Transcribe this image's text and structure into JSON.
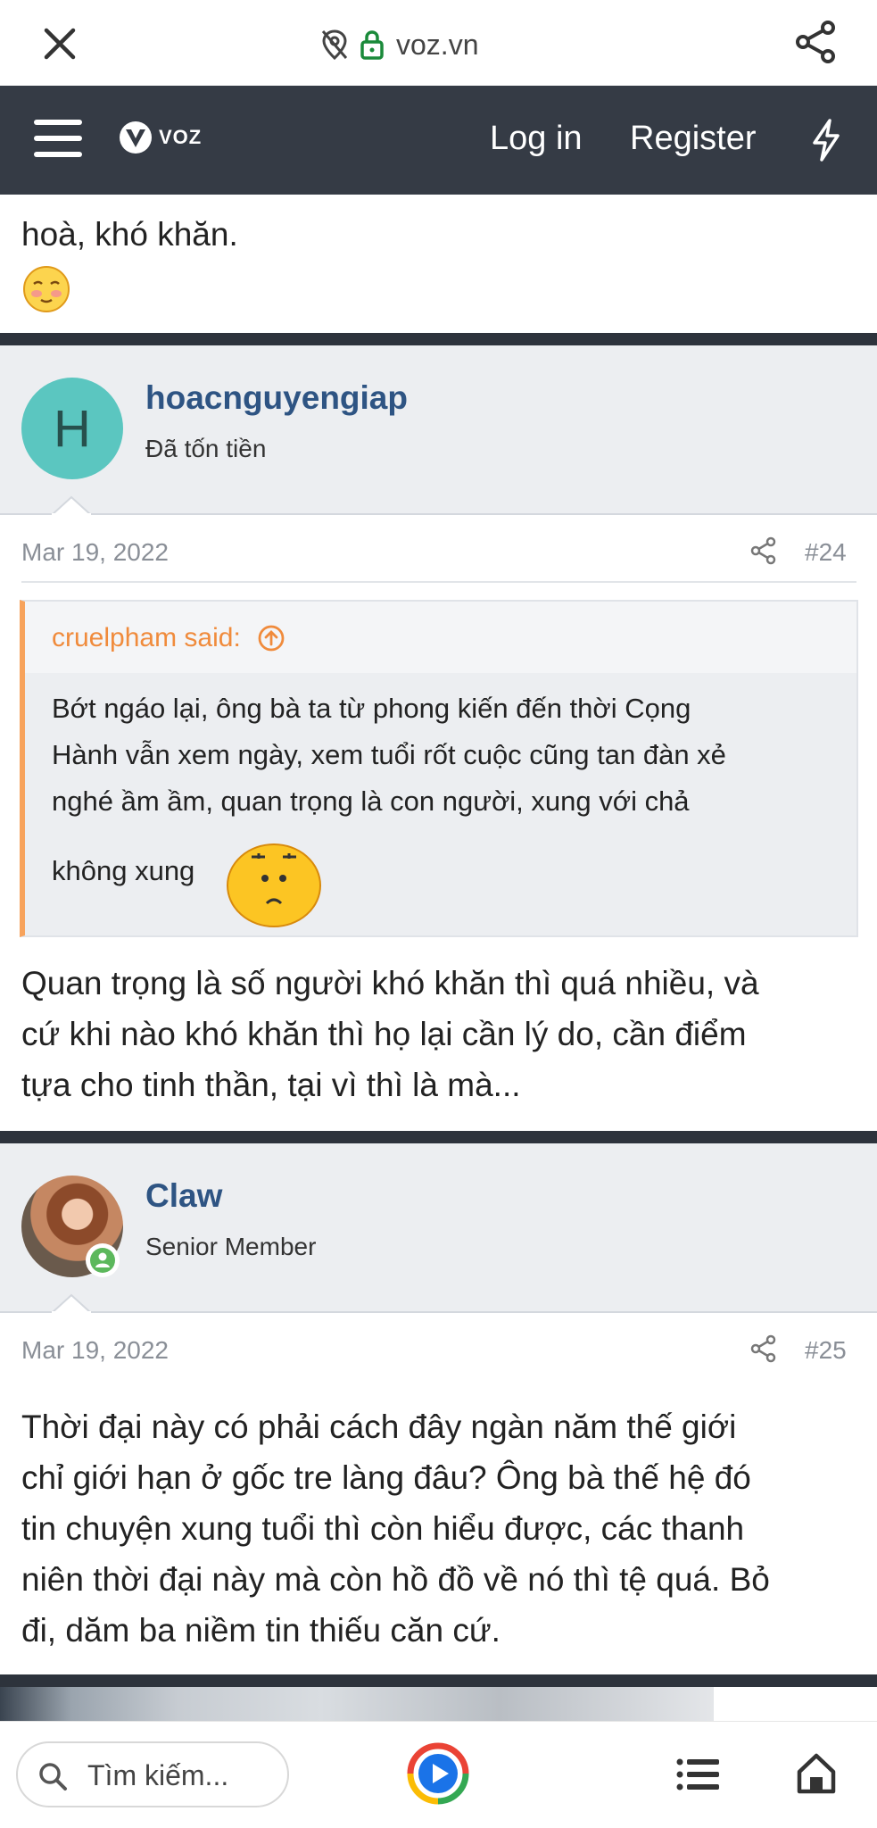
{
  "browser": {
    "domain": "voz.vn",
    "icons": [
      "close-icon",
      "tracking-off-icon",
      "lock-icon",
      "share-icon"
    ]
  },
  "site_header": {
    "logo_text": "VOZ",
    "login_label": "Log in",
    "register_label": "Register"
  },
  "previous_post": {
    "tail_text": "hoà, khó khăn."
  },
  "posts": [
    {
      "avatar_letter": "H",
      "avatar_color": "#5bc6c0",
      "username": "hoacnguyengiap",
      "user_title": "Đã tốn tiền",
      "date": "Mar 19, 2022",
      "number": "#24",
      "quote": {
        "author": "cruelpham said:",
        "lines": [
          "Bớt ngáo lại, ông bà ta từ phong kiến đến thời Cọng",
          "Hành vẫn xem ngày, xem tuổi rốt cuộc cũng tan đàn xẻ",
          "nghé ầm ầm, quan trọng là con người, xung với chả",
          "không xung"
        ]
      },
      "body_lines": [
        "Quan trọng là số người khó khăn thì quá nhiều, và",
        "cứ khi nào khó khăn thì họ lại cần lý do, cần điểm",
        "tựa cho tinh thần, tại vì thì là mà..."
      ]
    },
    {
      "username": "Claw",
      "user_title": "Senior Member",
      "online_color": "#5cb85c",
      "date": "Mar 19, 2022",
      "number": "#25",
      "body_lines": [
        "Thời đại này có phải cách đây ngàn năm thế giới",
        "chỉ giới hạn ở gốc tre làng đâu? Ông bà thế hệ đó",
        "tin chuyện xung tuổi thì còn hiểu được, các thanh",
        "niên thời đại này mà còn hồ đồ về nó thì tệ quá. Bỏ",
        "đi, dăm ba niềm tin thiếu căn cứ."
      ]
    }
  ],
  "bottom_bar": {
    "search_placeholder": "Tìm kiếm..."
  },
  "colors": {
    "header_bg": "#353b45",
    "username": "#2e5483",
    "quote_accent": "#f7a35c"
  }
}
